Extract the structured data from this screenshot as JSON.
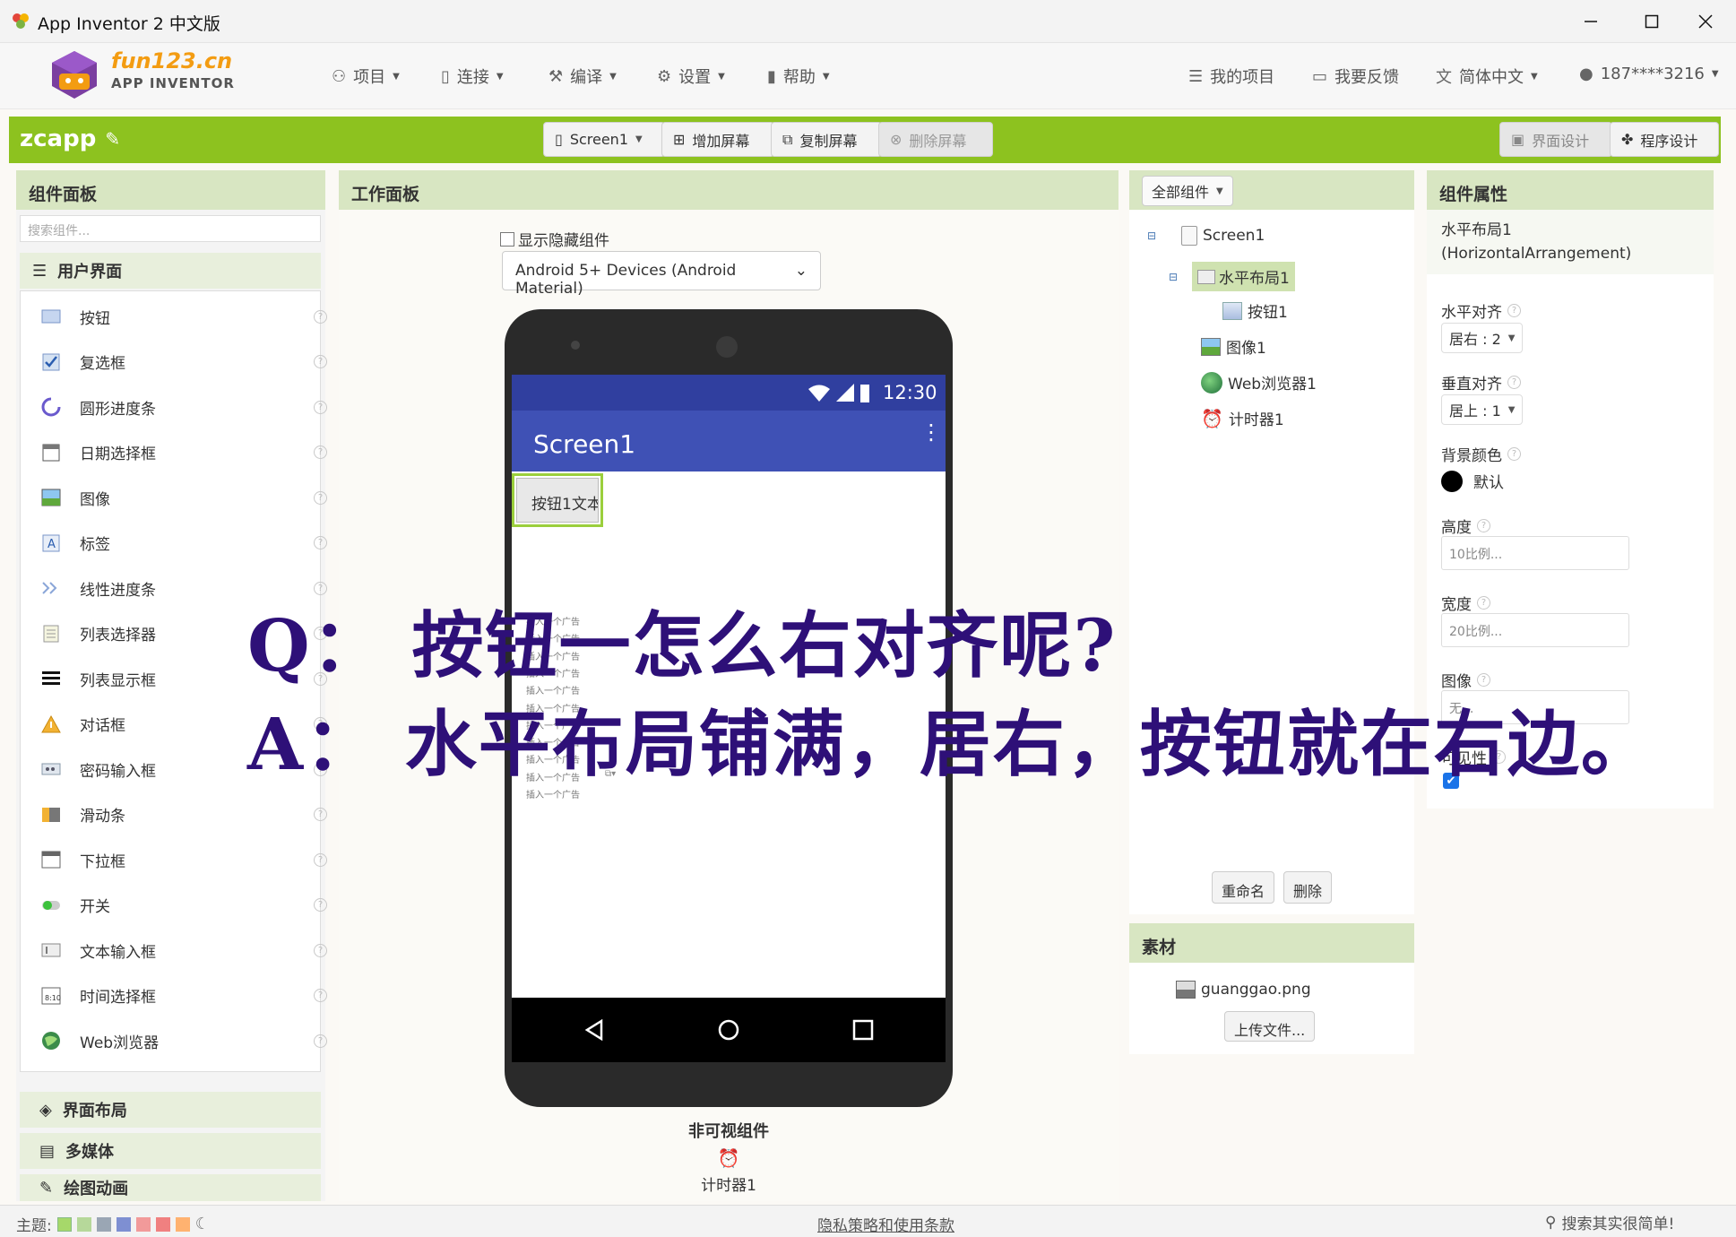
{
  "window": {
    "title": "App Inventor 2 中文版"
  },
  "header": {
    "logo_line1": "fun123.cn",
    "logo_line2": "APP INVENTOR",
    "menus": [
      {
        "label": "项目"
      },
      {
        "label": "连接"
      },
      {
        "label": "编译"
      },
      {
        "label": "设置"
      },
      {
        "label": "帮助"
      }
    ],
    "right": {
      "my_projects": "我的项目",
      "feedback": "我要反馈",
      "language": "简体中文",
      "user": "187****3216"
    }
  },
  "projectbar": {
    "project_name": "zcapp",
    "screen_select": "Screen1",
    "add_screen": "增加屏幕",
    "copy_screen": "复制屏幕",
    "delete_screen": "删除屏幕",
    "designer": "界面设计",
    "blocks": "程序设计"
  },
  "palette": {
    "title": "组件面板",
    "search_placeholder": "搜索组件...",
    "category_ui": "用户界面",
    "items": [
      {
        "label": "按钮"
      },
      {
        "label": "复选框"
      },
      {
        "label": "圆形进度条"
      },
      {
        "label": "日期选择框"
      },
      {
        "label": "图像"
      },
      {
        "label": "标签"
      },
      {
        "label": "线性进度条"
      },
      {
        "label": "列表选择器"
      },
      {
        "label": "列表显示框"
      },
      {
        "label": "对话框"
      },
      {
        "label": "密码输入框"
      },
      {
        "label": "滑动条"
      },
      {
        "label": "下拉框"
      },
      {
        "label": "开关"
      },
      {
        "label": "文本输入框"
      },
      {
        "label": "时间选择框"
      },
      {
        "label": "Web浏览器"
      }
    ],
    "help_glyph": "?",
    "categories": [
      {
        "label": "界面布局"
      },
      {
        "label": "多媒体"
      },
      {
        "label": "绘图动画"
      }
    ]
  },
  "viewer": {
    "title": "工作面板",
    "show_hidden": "显示隐藏组件",
    "device": "Android 5+ Devices (Android Material)",
    "status_time": "12:30",
    "screen_title": "Screen1",
    "button_text": "按钮1文本",
    "ad_text": "插入一个广告",
    "nonvisible_title": "非可视组件",
    "nonvisible_item": "计时器1"
  },
  "tree": {
    "dropdown": "全部组件",
    "nodes": [
      {
        "label": "Screen1"
      },
      {
        "label": "水平布局1"
      },
      {
        "label": "按钮1"
      },
      {
        "label": "图像1"
      },
      {
        "label": "Web浏览器1"
      },
      {
        "label": "计时器1"
      }
    ],
    "rename": "重命名",
    "delete": "删除"
  },
  "media": {
    "title": "素材",
    "file": "guanggao.png",
    "upload": "上传文件..."
  },
  "properties": {
    "title": "组件属性",
    "component_name": "水平布局1",
    "component_type": "(HorizontalArrangement)",
    "align_h_label": "水平对齐",
    "align_h_value": "居右 : 2",
    "align_v_label": "垂直对齐",
    "align_v_value": "居上 : 1",
    "bg_label": "背景颜色",
    "bg_value": "默认",
    "height_label": "高度",
    "height_value": "10比例...",
    "width_label": "宽度",
    "width_value": "20比例...",
    "image_label": "图像",
    "image_value": "无...",
    "visible_label": "可见性"
  },
  "footer": {
    "theme_label": "主题:",
    "privacy": "隐私策略和使用条款",
    "search": "搜索其实很简单!"
  },
  "colors": {
    "accent": "#8dc21f",
    "panel_head": "#d8e6c2",
    "phone_bar": "#3f51b5",
    "phone_status": "#303f9f",
    "overlay": "#2e1078"
  },
  "overlay": {
    "q": "Q：  按钮一怎么右对齐呢?",
    "a": "A：  水平布局铺满，居右，按钮就在右边。"
  }
}
